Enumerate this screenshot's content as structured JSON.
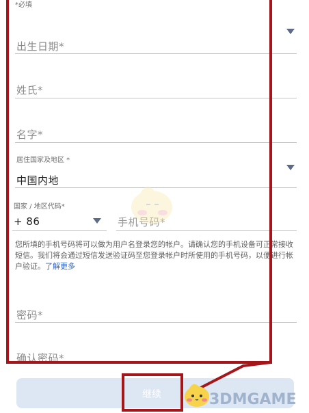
{
  "form": {
    "required_hint": "*必填",
    "birthdate_label": "出生日期*",
    "surname_label": "姓氏*",
    "givenname_label": "名字*",
    "region_label": "居住国家及地区 *",
    "region_value": "中国内地",
    "country_code_label": "国家 / 地区代码*",
    "country_code_value": "+ 86",
    "phone_label": "手机号码*",
    "phone_note": "您所填的手机号码将可以做为用户名登录您的帐户。请确认您的手机设备可正常接收短信。我们将会通过短信发送验证码至您登录帐户时所使用的手机号码，以便进行帐户验证。",
    "learn_more": "了解更多",
    "password_label": "密码*",
    "confirm_password_label": "确认密码*",
    "continue_label": "继续"
  },
  "watermark": {
    "brand": "3DMGAME"
  },
  "icons": {
    "dropdown": "chevron-down-icon",
    "mascot": "mascot-icon"
  },
  "colors": {
    "highlight": "#a4161a",
    "link": "#2d65c8",
    "dropdown_arrow": "#5d6b86",
    "button_bg": "#dde6f3"
  }
}
